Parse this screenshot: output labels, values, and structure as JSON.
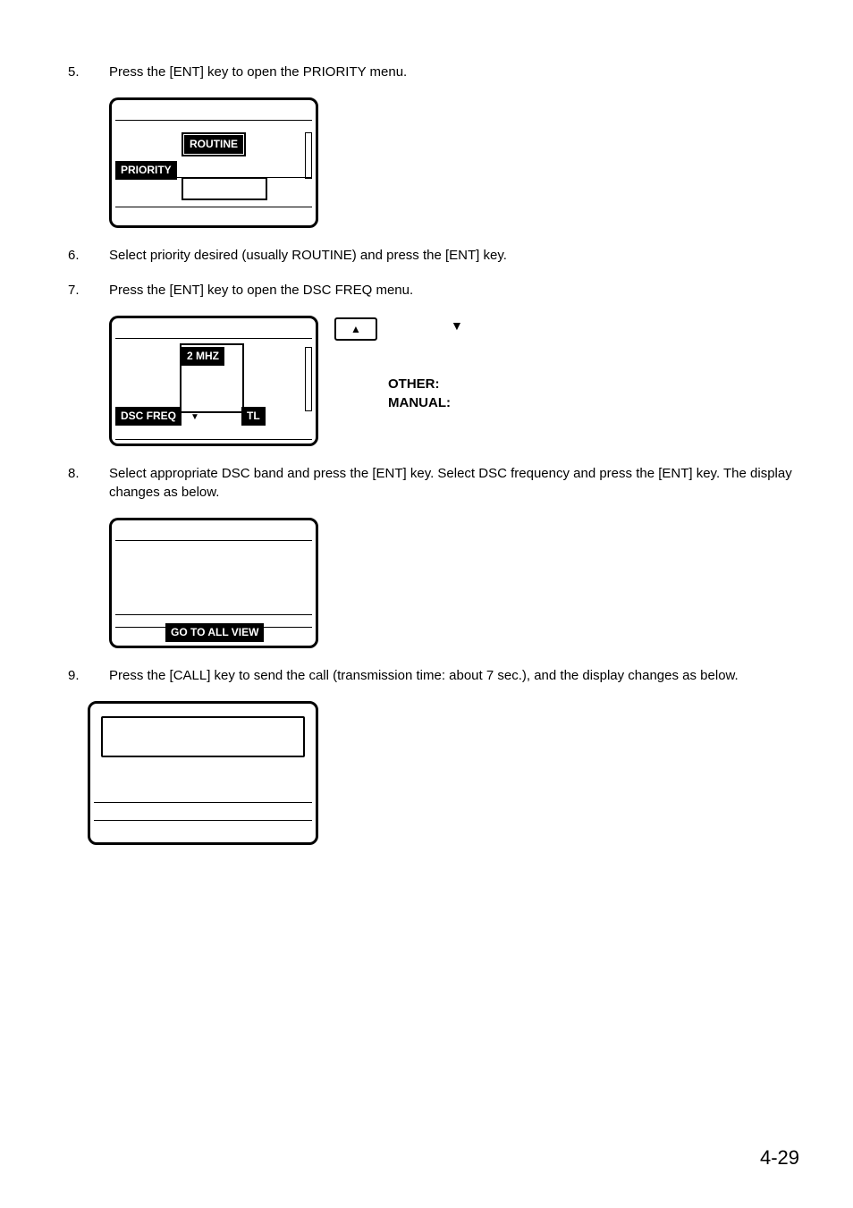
{
  "steps": {
    "s5": {
      "num": "5.",
      "text": "Press the [ENT] key to open the PRIORITY menu."
    },
    "s6": {
      "num": "6.",
      "text": "Select priority desired (usually ROUTINE) and press the [ENT] key."
    },
    "s7": {
      "num": "7.",
      "text": "Press the [ENT] key to open the DSC FREQ menu."
    },
    "s8": {
      "num": "8.",
      "text": "Select appropriate DSC band and press the [ENT] key. Select DSC frequency and press the [ENT] key. The display changes as below."
    },
    "s9": {
      "num": "9.",
      "text": "Press the [CALL] key to send the call (transmission time: about 7 sec.), and the display changes as below."
    }
  },
  "fig1": {
    "priority_label": "PRIORITY",
    "routine": "ROUTINE"
  },
  "fig2": {
    "dsc_label": "DSC FREQ",
    "mhz": "2 MHZ",
    "tl": "TL",
    "other": "OTHER:",
    "manual": "MANUAL:"
  },
  "fig3": {
    "goto": "GO TO ALL VIEW"
  },
  "page_number": "4-29",
  "arrows": {
    "up": "▲",
    "down": "▼",
    "down_small": "▼"
  }
}
